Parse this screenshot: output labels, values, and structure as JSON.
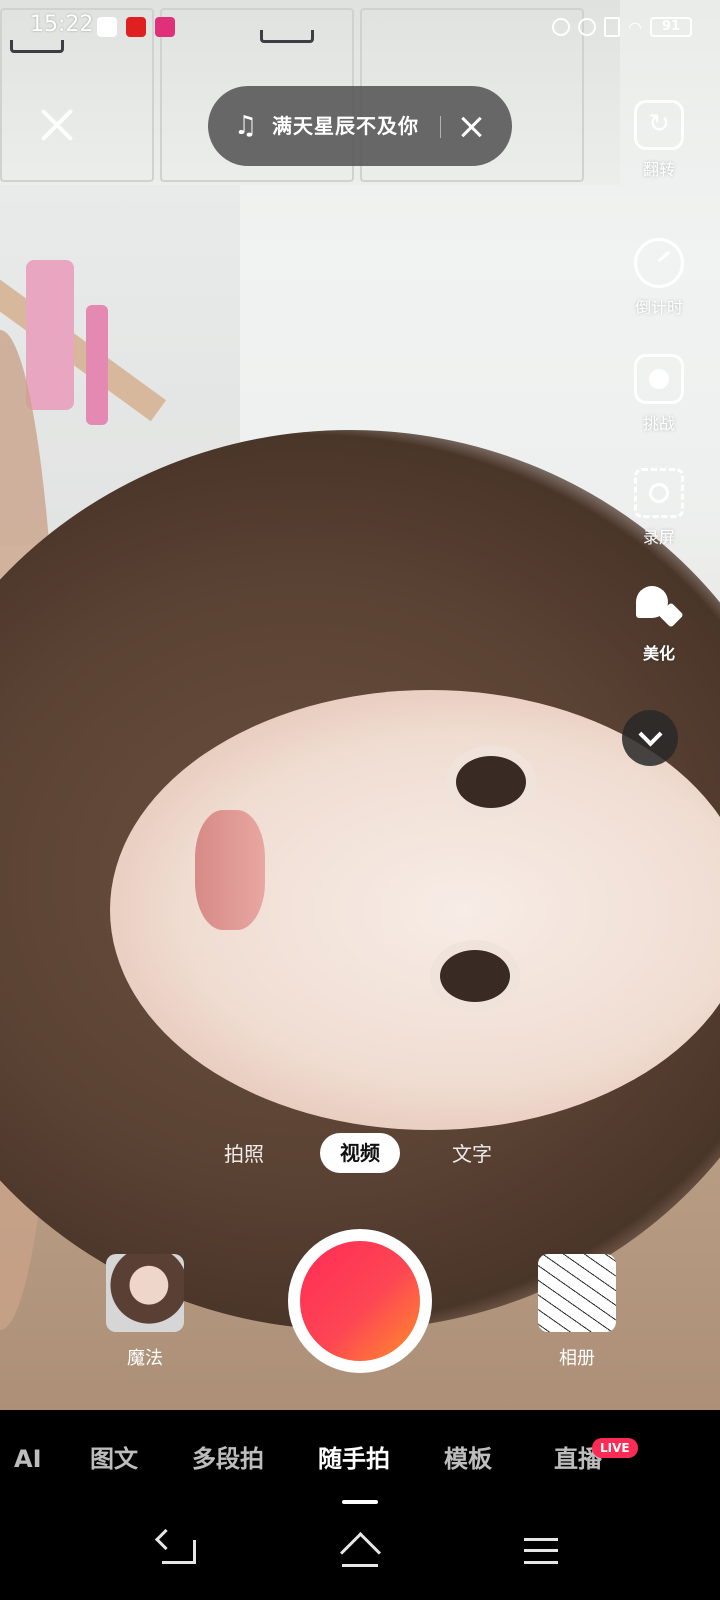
{
  "status_bar": {
    "time": "15:22",
    "battery": "91",
    "icons": [
      "baidu-app-icon",
      "red-app-icon",
      "bilibili-app-icon",
      "alarm-icon",
      "mute-icon",
      "sim-icon",
      "wifi-icon",
      "battery-icon"
    ]
  },
  "music": {
    "note_glyph": "♫",
    "title": "满天星辰不及你"
  },
  "side_tools": [
    {
      "name": "flip-camera",
      "label": "翻转",
      "icon": "flip-camera-icon"
    },
    {
      "name": "countdown",
      "label": "倒计时",
      "icon": "timer-icon"
    },
    {
      "name": "challenge",
      "label": "挑战",
      "icon": "challenge-icon"
    },
    {
      "name": "scene",
      "label": "录屏",
      "icon": "scene-icon"
    },
    {
      "name": "beautify",
      "label": "美化",
      "icon": "beautify-icon"
    }
  ],
  "capture_modes": {
    "left": "拍照",
    "active": "视频",
    "right": "文字"
  },
  "magic_label": "魔法",
  "album_label": "相册",
  "bottom_tabs": [
    "AI",
    "图文",
    "多段拍",
    "随手拍",
    "模板",
    "直播"
  ],
  "active_tab_index": 3,
  "live_badge": "LIVE",
  "colors": {
    "record_start": "#fe2c55",
    "record_end": "#ff8f2a",
    "live_badge": "#fe2c55"
  }
}
